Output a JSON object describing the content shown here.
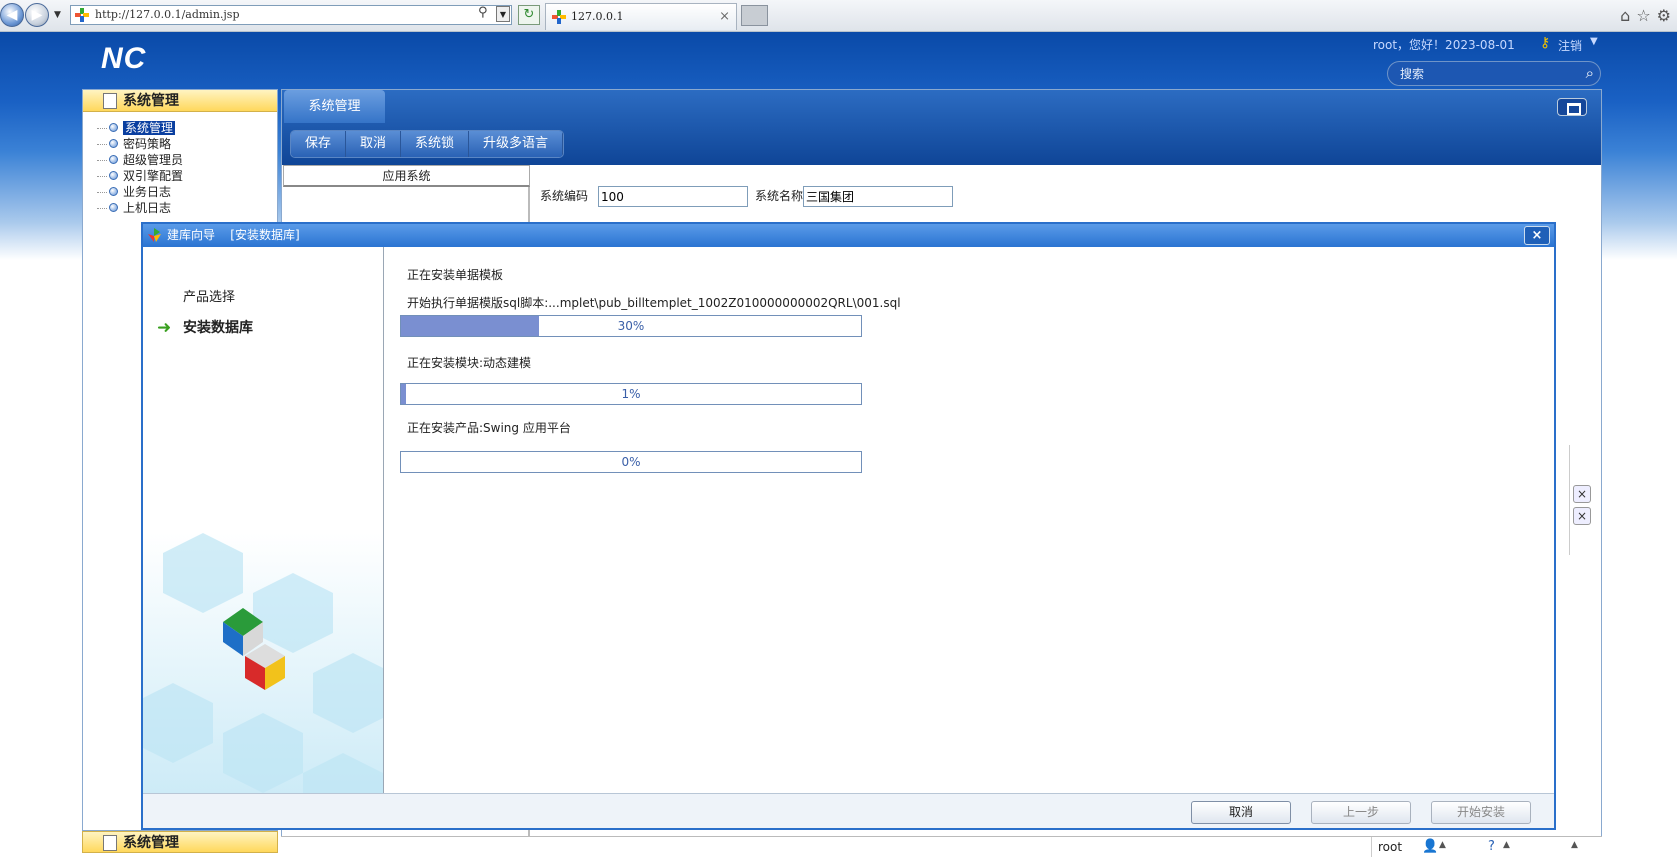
{
  "browser": {
    "url": "http://127.0.0.1/admin.jsp",
    "tab_title": "127.0.0.1",
    "tab_close": "×",
    "search_glyph": "⚲",
    "dropdown_glyph": "▼",
    "refresh_glyph": "↻",
    "right_icons": "⌂☆⚙"
  },
  "header": {
    "logo": "NC",
    "greeting": "root，您好！2023-08-01",
    "logout": "注销",
    "search_placeholder": "搜索"
  },
  "left_panel": {
    "title": "系统管理",
    "items": [
      "系统管理",
      "密码策略",
      "超级管理员",
      "双引擎配置",
      "业务日志",
      "上机日志"
    ],
    "selected_index": 0,
    "bottom_title": "系统管理"
  },
  "main": {
    "tab": "系统管理",
    "toolbar": [
      "保存",
      "取消",
      "系统锁",
      "升级多语言"
    ],
    "app_list_header": "应用系统",
    "code_label": "系统编码",
    "code_value": "100",
    "name_label": "系统名称",
    "name_value": "三国集团",
    "side_close": "×"
  },
  "status_bar": {
    "user": "root",
    "user_icon": "person-icon",
    "help_icon": "help-icon"
  },
  "dialog": {
    "title": "建库向导    [安装数据库]",
    "close": "×",
    "steps": [
      {
        "label": "产品选择",
        "active": false
      },
      {
        "label": "安装数据库",
        "active": true
      }
    ],
    "tasks": [
      {
        "line1": "正在安装单据模板",
        "line2": "开始执行单据模版sql脚本:...mplet\\pub_billtemplet_1002Z010000000002QRL\\001.sql",
        "percent": 30,
        "percent_label": "30%"
      },
      {
        "line1": "正在安装模块:动态建模",
        "line2": "",
        "percent": 1,
        "percent_label": "1%"
      },
      {
        "line1": "正在安装产品:Swing 应用平台",
        "line2": "",
        "percent": 0,
        "percent_label": "0%"
      }
    ],
    "buttons": {
      "cancel": "取消",
      "prev": "上一步",
      "start": "开始安装"
    }
  },
  "colors": {
    "header_blue": "#0a4aa8",
    "progress_fill": "#7a8fd1",
    "tree_selected": "#0a3fa0",
    "panel_title_yellow": "#ffd85c"
  }
}
